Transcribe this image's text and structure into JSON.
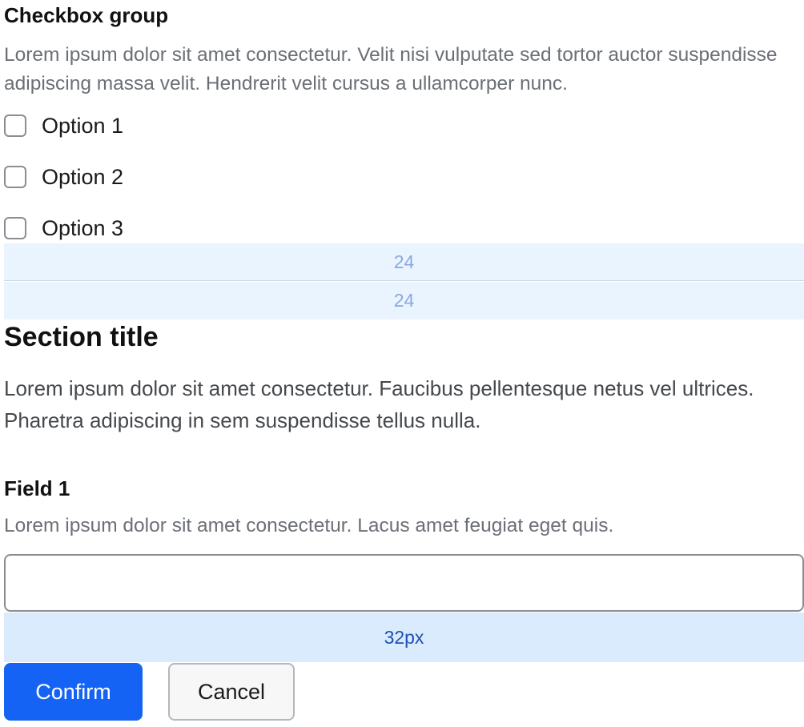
{
  "checkbox_group": {
    "title": "Checkbox group",
    "description": "Lorem ipsum dolor sit amet consectetur. Velit nisi vulputate sed tortor auctor suspendisse adipiscing massa velit. Hendrerit velit cursus a ullamcorper nunc.",
    "options": [
      {
        "label": "Option 1",
        "checked": false
      },
      {
        "label": "Option 2",
        "checked": false
      },
      {
        "label": "Option 3",
        "checked": false
      }
    ]
  },
  "spacing_annotations": {
    "first": "24",
    "second": "24",
    "third": "32px"
  },
  "section": {
    "title": "Section title",
    "description": "Lorem ipsum dolor sit amet consectetur. Faucibus pellentesque netus vel ultrices. Pharetra adipiscing in sem suspendisse tellus nulla."
  },
  "field": {
    "label": "Field 1",
    "description": "Lorem ipsum dolor sit amet consectetur. Lacus amet feugiat eget quis.",
    "value": "",
    "placeholder": ""
  },
  "actions": {
    "confirm_label": "Confirm",
    "cancel_label": "Cancel"
  },
  "colors": {
    "primary": "#1463f5",
    "spacer_light": "#eaf4fe",
    "spacer_strong": "#d9ebfd",
    "muted_text": "#6b6f76"
  }
}
